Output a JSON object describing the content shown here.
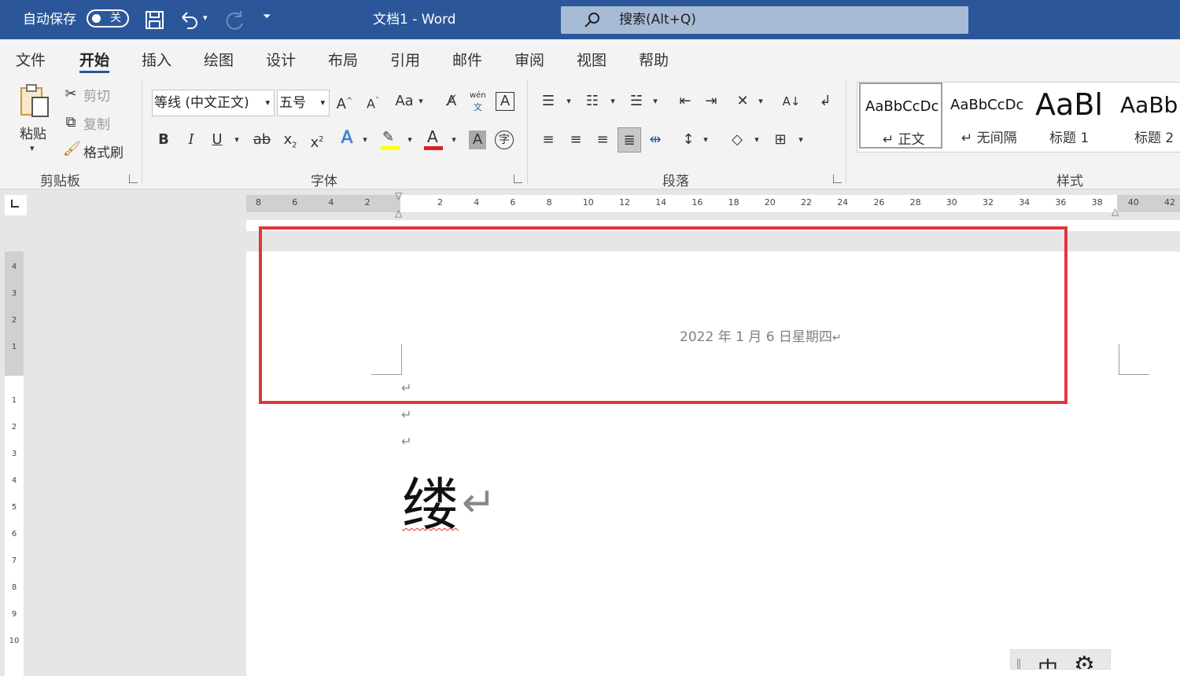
{
  "titlebar": {
    "autosave_label": "自动保存",
    "autosave_state": "关",
    "doc_title": "文档1  -  Word",
    "search_placeholder": "搜索(Alt+Q)"
  },
  "tabs": [
    "文件",
    "开始",
    "插入",
    "绘图",
    "设计",
    "布局",
    "引用",
    "邮件",
    "审阅",
    "视图",
    "帮助"
  ],
  "active_tab": "开始",
  "clipboard": {
    "paste": "粘贴",
    "cut": "剪切",
    "copy": "复制",
    "painter": "格式刷",
    "group": "剪贴板"
  },
  "font": {
    "name": "等线 (中文正文)",
    "size": "五号",
    "group": "字体",
    "aa": "Aa",
    "pinyin_top": "wén",
    "pinyin_bottom": "文"
  },
  "paragraph": {
    "group": "段落"
  },
  "styles": {
    "group": "样式",
    "items": [
      {
        "preview": "AaBbCcDc",
        "name": "正文"
      },
      {
        "preview": "AaBbCcDc",
        "name": "无间隔"
      },
      {
        "preview": "AaBl",
        "name": "标题 1"
      },
      {
        "preview": "AaBb",
        "name": "标题 2"
      }
    ]
  },
  "ruler": {
    "h_numbers": [
      "8",
      "6",
      "4",
      "2",
      "2",
      "4",
      "6",
      "8",
      "10",
      "12",
      "14",
      "16",
      "18",
      "20",
      "22",
      "24",
      "26",
      "28",
      "30",
      "32",
      "34",
      "36",
      "38",
      "40",
      "42"
    ],
    "v_numbers_top": [
      "4",
      "3",
      "2",
      "1"
    ],
    "v_numbers_bottom": [
      "1",
      "2",
      "3",
      "4",
      "5",
      "6",
      "7",
      "8",
      "9",
      "10"
    ]
  },
  "document": {
    "header_date": "2022 年 1 月 6 日星期四",
    "big_char": "缕",
    "return_mark": "↵"
  },
  "ime": {
    "mode": "中"
  }
}
